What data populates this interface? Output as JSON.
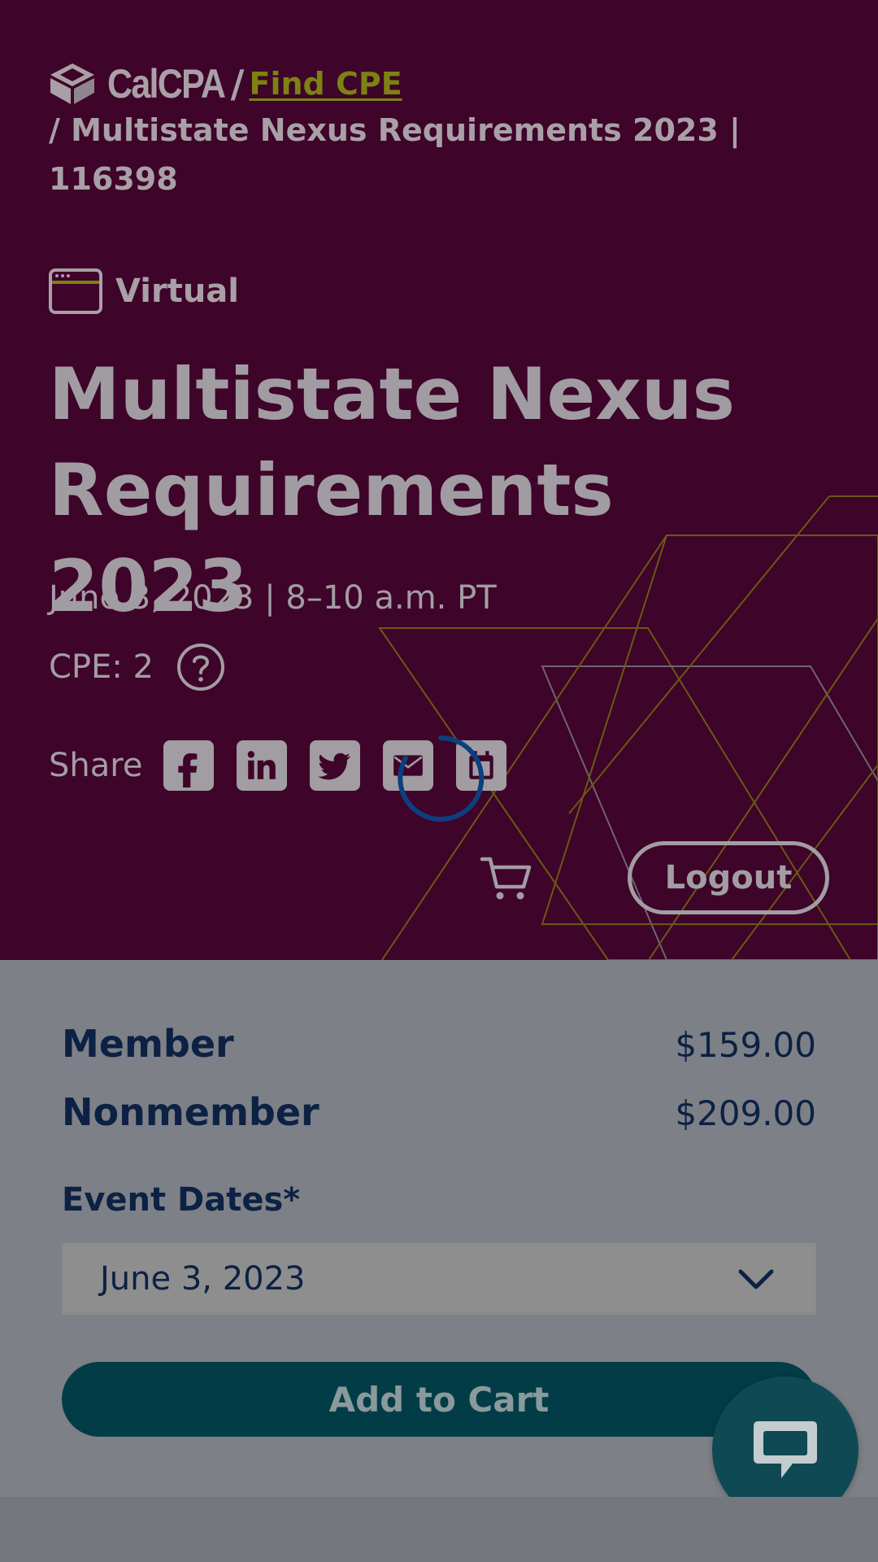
{
  "brand": {
    "logo_text": "CalCPA",
    "separator": "/"
  },
  "breadcrumb": {
    "link_label": "Find CPE",
    "current": "/ Multistate Nexus Requirements 2023 | 116398"
  },
  "event": {
    "format": "Virtual",
    "format_icon": "browser-window-icon",
    "title": "Multistate Nexus Requirements 2023",
    "date_time": "June 3, 2023 | 8–10 a.m. PT",
    "cpe": "CPE: 2"
  },
  "share": {
    "label": "Share",
    "icons": [
      "facebook-icon",
      "linkedin-icon",
      "twitter-icon",
      "email-icon",
      "calendar-icon"
    ]
  },
  "header_actions": {
    "logout_label": "Logout",
    "cart_icon": "cart-icon"
  },
  "pricing": {
    "member_label": "Member",
    "member_price": "$159.00",
    "nonmember_label": "Nonmember",
    "nonmember_price": "$209.00"
  },
  "event_dates": {
    "label": "Event Dates*",
    "selected": "June 3, 2023"
  },
  "add_to_cart_label": "Add to Cart",
  "chat_icon": "chat-bubble-icon",
  "colors": {
    "hero_bg": "#3e0429",
    "link_olive": "#7d8211",
    "navy_text": "#0c2144",
    "teal_button": "#023d47",
    "overlay_gray": "#7d8086",
    "spinner_blue": "#0d3f80"
  }
}
